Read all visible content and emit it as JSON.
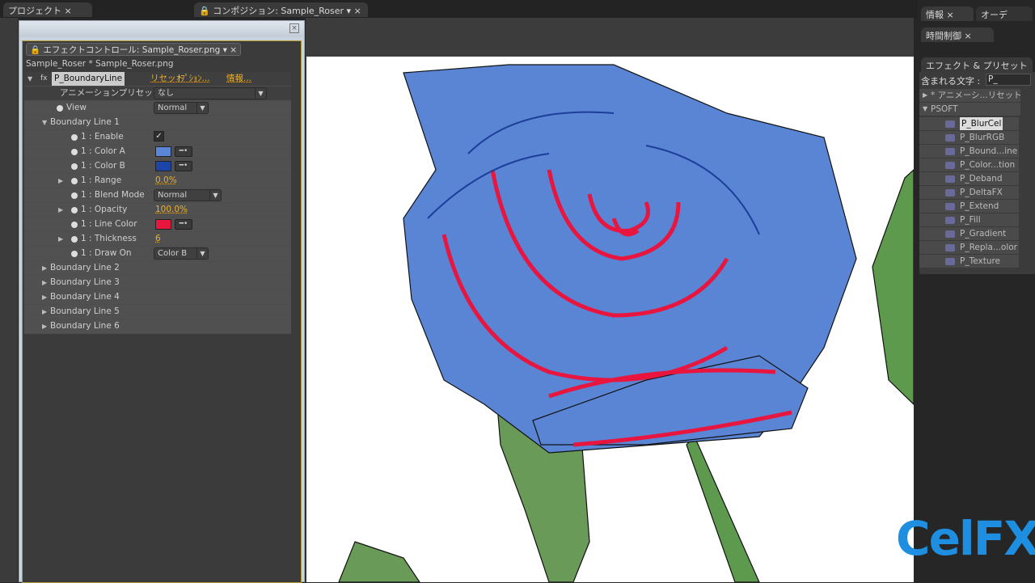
{
  "tabs": {
    "project": "プロジェクト",
    "composition": "コンポジション: Sample_Roser"
  },
  "effect_controls": {
    "tab_label": "エフェクトコントロール: Sample_Roser.png",
    "breadcrumb": "Sample_Roser * Sample_Roser.png",
    "effect_name": "P_BoundaryLine",
    "reset": "リセット",
    "options": "ｵﾌﾟｼｮﾝ...",
    "about": "情報...",
    "preset_label": "アニメーションプリセット :",
    "preset_value": "なし",
    "view_label": "View",
    "view_value": "Normal",
    "group1": "Boundary Line 1",
    "props": [
      {
        "label": "1 : Enable",
        "value": "✓"
      },
      {
        "label": "1 : Color A",
        "value": "#5b86d8"
      },
      {
        "label": "1 : Color B",
        "value": "#1f44a8"
      },
      {
        "label": "1 : Range",
        "value": "0.0%"
      },
      {
        "label": "1 : Blend Mode",
        "value": "Normal"
      },
      {
        "label": "1 : Opacity",
        "value": "100.0%"
      },
      {
        "label": "1 : Line Color",
        "value": "#e8163f"
      },
      {
        "label": "1 : Thickness",
        "value": "6"
      },
      {
        "label": "1 : Draw On",
        "value": "Color B"
      }
    ],
    "groups": [
      "Boundary Line 2",
      "Boundary Line 3",
      "Boundary Line 4",
      "Boundary Line 5",
      "Boundary Line 6"
    ]
  },
  "right": {
    "info_tab": "情報",
    "audio_tab": "オーデ",
    "time_tab": "時間制御",
    "effects_tab": "エフェクト & プリセット",
    "search_label": "含まれる文字 :",
    "search_value": "P_",
    "anim_presets": "* アニメーシ...リセット",
    "category": "PSOFT",
    "items": [
      "P_BlurCel",
      "P_BlurRGB",
      "P_Bound...ine",
      "P_Color...tion",
      "P_Deband",
      "P_DeltaFX",
      "P_Extend",
      "P_Fill",
      "P_Gradient",
      "P_Repla...olor",
      "P_Texture"
    ]
  },
  "watermark": "CelFX"
}
